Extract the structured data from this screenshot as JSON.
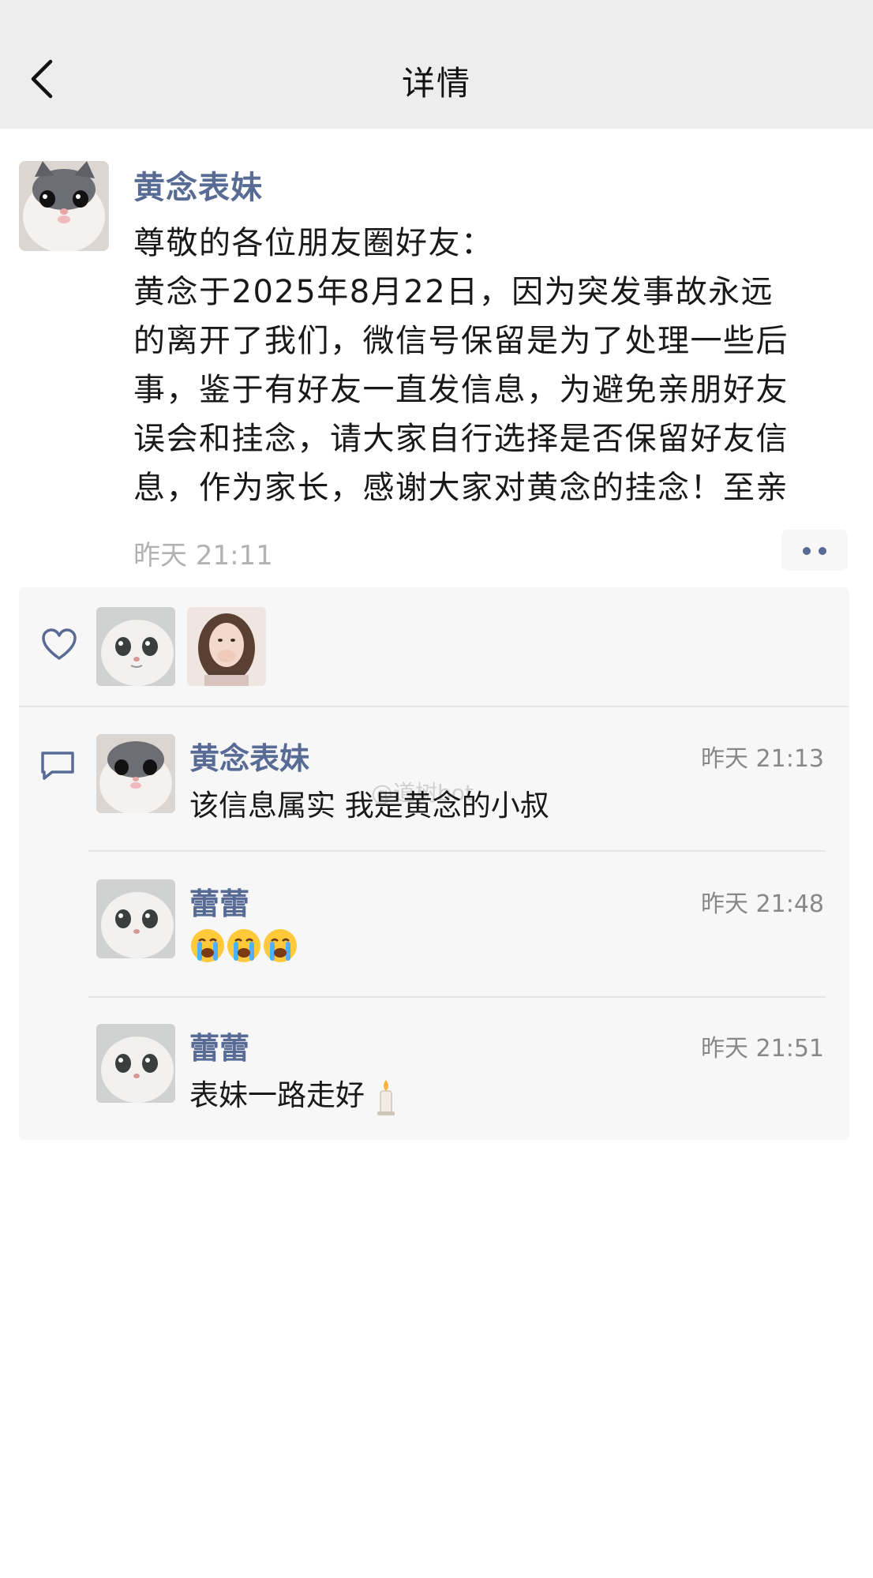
{
  "nav": {
    "title": "详情",
    "back_icon": "chevron-left-icon"
  },
  "post": {
    "author": "黄念表妹",
    "content_lines": [
      "尊敬的各位朋友圈好友：",
      "黄念于2025年8月22日，因为突发事故永远",
      "的离开了我们，微信号保留是为了处理一些后",
      "事，鉴于有好友一直发信息，为避免亲朋好友",
      "误会和挂念，请大家自行选择是否保留好友信",
      "息，作为家长，感谢大家对黄念的挂念！至亲"
    ],
    "time": "昨天 21:11",
    "more_icon": "more-dots-icon"
  },
  "likes": {
    "icon": "heart-icon",
    "avatars": [
      "cat-avatar",
      "girl-avatar"
    ]
  },
  "comments": [
    {
      "name": "黄念表妹",
      "time": "昨天 21:13",
      "text": "该信息属实 我是黄念的小叔"
    },
    {
      "name": "蕾蕾",
      "time": "昨天 21:48",
      "text": "",
      "emoji": "crying-face-icon x3"
    },
    {
      "name": "蕾蕾",
      "time": "昨天 21:51",
      "text": "表妹一路走好",
      "emoji": "candle-icon"
    }
  ],
  "watermark": "@道树bot",
  "colors": {
    "link": "#576b95",
    "nav_bg": "#ededed",
    "panel_bg": "#f7f7f7",
    "time": "#b2b2b2"
  }
}
